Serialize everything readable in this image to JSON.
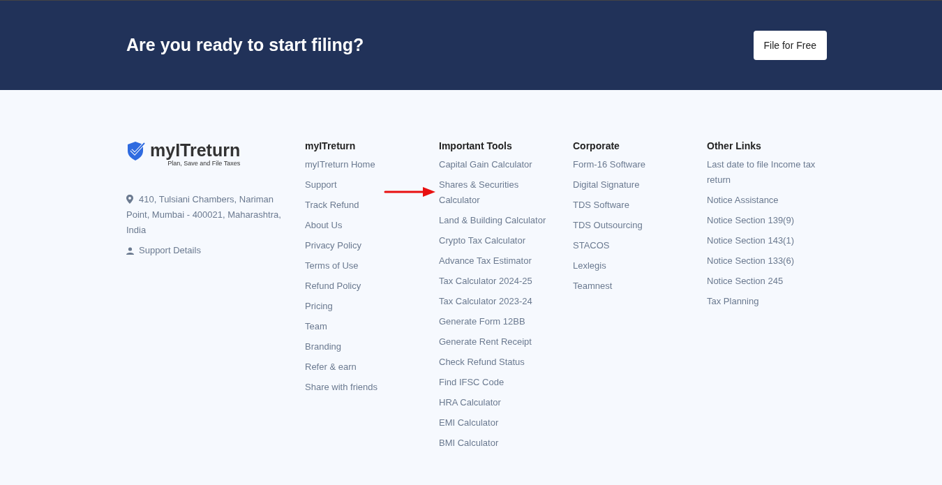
{
  "banner": {
    "title": "Are you ready to start filing?",
    "button": "File for Free"
  },
  "brand": {
    "name": "myITreturn",
    "tagline": "Plan, Save and File Taxes",
    "address": "410, Tulsiani Chambers, Nariman Point, Mumbai - 400021, Maharashtra, India",
    "support": "Support Details"
  },
  "columns": [
    {
      "heading": "myITreturn",
      "links": [
        "myITreturn Home",
        "Support",
        "Track Refund",
        "About Us",
        "Privacy Policy",
        "Terms of Use",
        "Refund Policy",
        "Pricing",
        "Team",
        "Branding",
        "Refer & earn",
        "Share with friends"
      ]
    },
    {
      "heading": "Important Tools",
      "links": [
        "Capital Gain Calculator",
        "Shares & Securities Calculator",
        "Land & Building Calculator",
        "Crypto Tax Calculator",
        "Advance Tax Estimator",
        "Tax Calculator 2024-25",
        "Tax Calculator 2023-24",
        "Generate Form 12BB",
        "Generate Rent Receipt",
        "Check Refund Status",
        "Find IFSC Code",
        "HRA Calculator",
        "EMI Calculator",
        "BMI Calculator"
      ]
    },
    {
      "heading": "Corporate",
      "links": [
        "Form-16 Software",
        "Digital Signature",
        "TDS Software",
        "TDS Outsourcing",
        "STACOS",
        "Lexlegis",
        "Teamnest"
      ]
    },
    {
      "heading": "Other Links",
      "links": [
        "Last date to file Income tax return",
        "Notice Assistance",
        "Notice Section 139(9)",
        "Notice Section 143(1)",
        "Notice Section 133(6)",
        "Notice Section 245",
        "Tax Planning"
      ]
    }
  ]
}
